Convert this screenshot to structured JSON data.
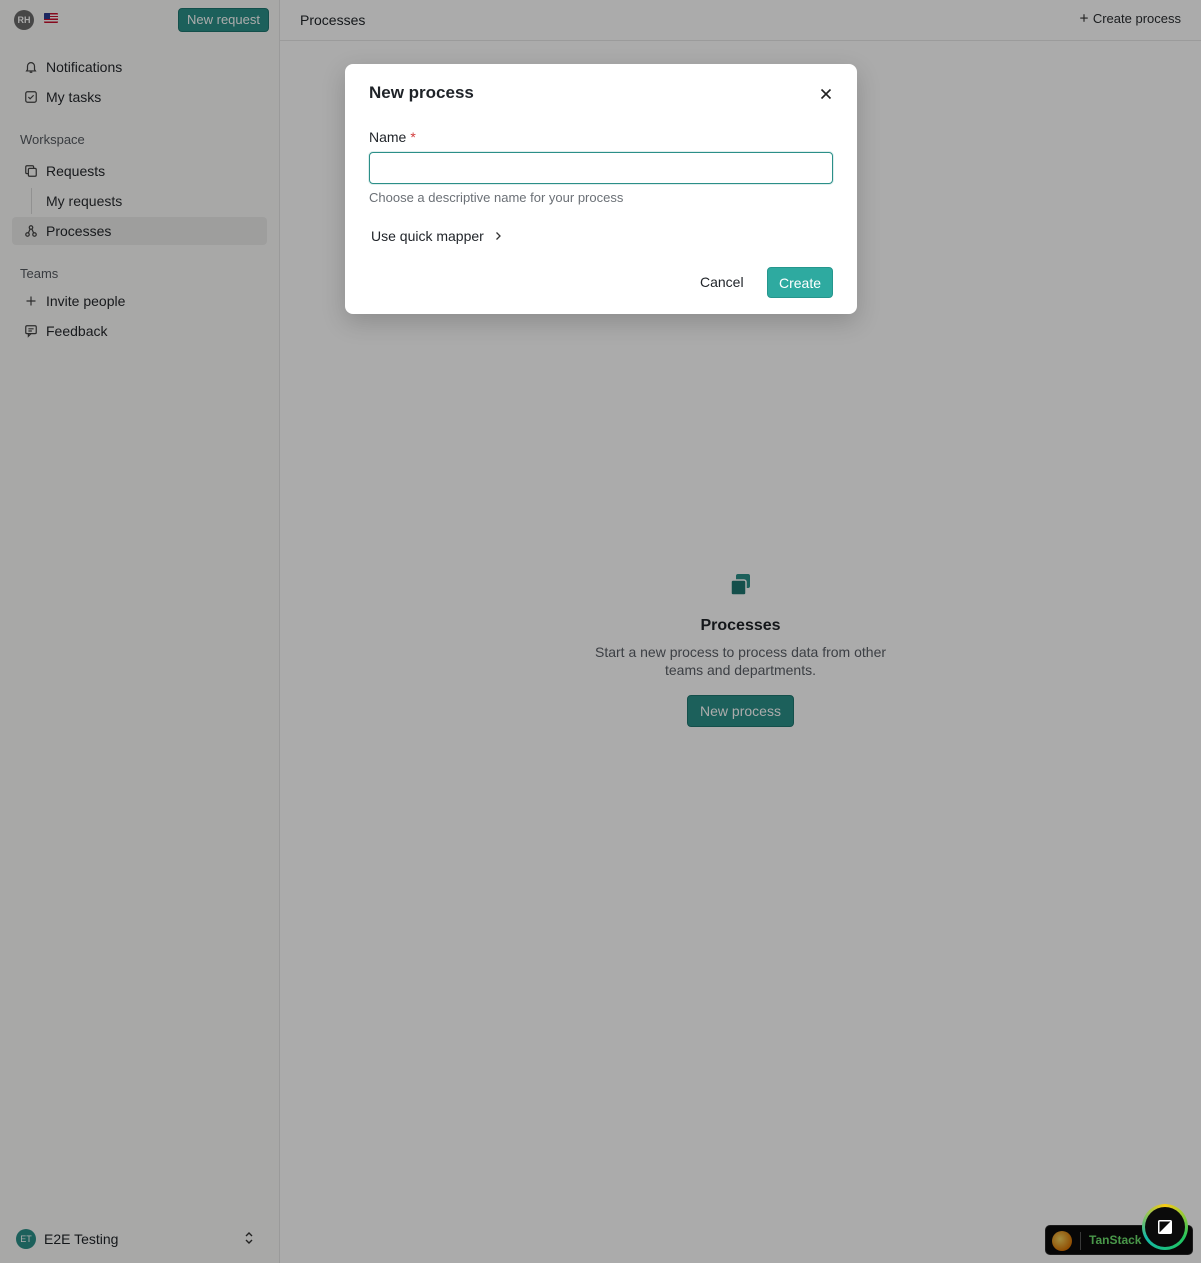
{
  "sidebar": {
    "user_initials": "RH",
    "new_request_label": "New request",
    "top_items": [
      {
        "label": "Notifications",
        "icon": "bell-icon"
      },
      {
        "label": "My tasks",
        "icon": "task-check-icon"
      }
    ],
    "workspace_label": "Workspace",
    "workspace_items": [
      {
        "label": "Requests",
        "icon": "copy-icon"
      },
      {
        "label": "My requests"
      },
      {
        "label": "Processes",
        "icon": "process-nodes-icon",
        "active": true
      }
    ],
    "teams_label": "Teams",
    "team_items": [
      {
        "label": "Invite people",
        "icon": "plus-icon"
      },
      {
        "label": "Feedback",
        "icon": "feedback-icon"
      }
    ],
    "workspace_switcher": {
      "initials": "ET",
      "name": "E2E Testing"
    }
  },
  "header": {
    "title": "Processes",
    "create_label": "Create process"
  },
  "empty_state": {
    "title": "Processes",
    "description": "Start a new process to process data from other teams and departments.",
    "button_label": "New process"
  },
  "modal": {
    "title": "New process",
    "name_label": "Name",
    "required_mark": "*",
    "name_value": "",
    "name_placeholder": "",
    "help_text": "Choose a descriptive name for your process",
    "quick_mapper_label": "Use quick mapper",
    "cancel_label": "Cancel",
    "create_label": "Create"
  },
  "devtools": {
    "label": "TanStack"
  },
  "colors": {
    "accent": "#2b8f88",
    "create_button": "#2eaaa0",
    "required": "#d23b3b"
  }
}
